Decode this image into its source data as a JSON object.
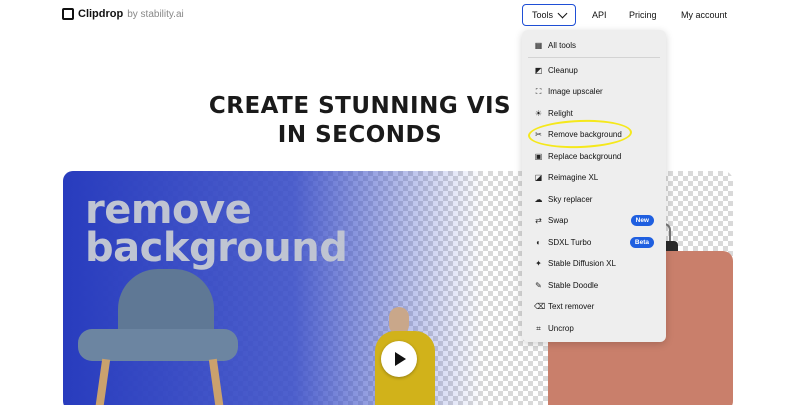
{
  "header": {
    "logo_text": "Clipdrop",
    "logo_sub": "by stability.ai",
    "nav": {
      "tools_label": "Tools",
      "api_label": "API",
      "pricing_label": "Pricing",
      "account_label": "My account"
    }
  },
  "hero": {
    "headline_line1": "CREATE STUNNING VIS",
    "headline_line2": "IN SECONDS",
    "image_title_line1": "remove",
    "image_title_line2": "background"
  },
  "dropdown": {
    "items": [
      {
        "label": "All tools",
        "icon": "grid-icon"
      },
      {
        "label": "Cleanup",
        "icon": "eraser-icon"
      },
      {
        "label": "Image upscaler",
        "icon": "upscale-icon"
      },
      {
        "label": "Relight",
        "icon": "bulb-icon"
      },
      {
        "label": "Remove background",
        "icon": "scissors-icon"
      },
      {
        "label": "Replace background",
        "icon": "image-icon"
      },
      {
        "label": "Reimagine XL",
        "icon": "reimagine-icon"
      },
      {
        "label": "Sky replacer",
        "icon": "cloud-icon"
      },
      {
        "label": "Swap",
        "icon": "swap-icon",
        "badge": "New"
      },
      {
        "label": "SDXL Turbo",
        "icon": "turbo-icon",
        "badge": "Beta"
      },
      {
        "label": "Stable Diffusion XL",
        "icon": "sparkle-icon"
      },
      {
        "label": "Stable Doodle",
        "icon": "pencil-icon"
      },
      {
        "label": "Text remover",
        "icon": "text-eraser-icon"
      },
      {
        "label": "Uncrop",
        "icon": "crop-icon"
      }
    ]
  },
  "colors": {
    "accent": "#1f4fd6",
    "badge": "#1f5fe0",
    "highlight": "#f5e81b",
    "hero_blue": "#283cbe"
  }
}
